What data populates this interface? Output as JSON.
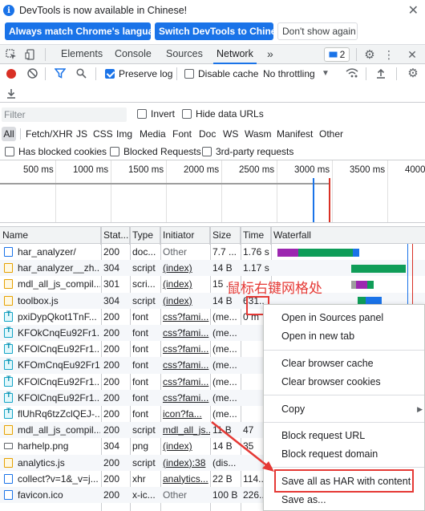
{
  "infobar": {
    "message": "DevTools is now available in Chinese!",
    "btn_match": "Always match Chrome's language",
    "btn_switch": "Switch DevTools to Chinese",
    "btn_dismiss": "Don't show again",
    "close": "✕"
  },
  "tabs": {
    "elements": "Elements",
    "console": "Console",
    "sources": "Sources",
    "network": "Network",
    "more": "»",
    "issues_count": "2"
  },
  "toolbar": {
    "preserve_log": "Preserve log",
    "disable_cache": "Disable cache",
    "throttling": "No throttling"
  },
  "filter": {
    "placeholder": "Filter",
    "invert": "Invert",
    "hide_data_urls": "Hide data URLs",
    "types": [
      "All",
      "Fetch/XHR",
      "JS",
      "CSS",
      "Img",
      "Media",
      "Font",
      "Doc",
      "WS",
      "Wasm",
      "Manifest",
      "Other"
    ],
    "has_blocked_cookies": "Has blocked cookies",
    "blocked_requests": "Blocked Requests",
    "third_party": "3rd-party requests"
  },
  "overview": {
    "ticks": [
      "500 ms",
      "1000 ms",
      "1500 ms",
      "2000 ms",
      "2500 ms",
      "3000 ms",
      "3500 ms",
      "4000"
    ]
  },
  "table": {
    "headers": [
      "Name",
      "Stat...",
      "Type",
      "Initiator",
      "Size",
      "Time",
      "Waterfall"
    ],
    "rows": [
      {
        "name": "har_analyzer/",
        "status": "200",
        "type": "doc...",
        "initiator": "Other",
        "size": "7.7 ...",
        "time": "1.76 s",
        "icon": "doc",
        "init_link": false
      },
      {
        "name": "har_analyzer__zh...",
        "status": "304",
        "type": "script",
        "initiator": "(index)",
        "size": "14 B",
        "time": "1.17 s",
        "icon": "js",
        "init_link": true
      },
      {
        "name": "mdl_all_js_compil...",
        "status": "301",
        "type": "scri...",
        "initiator": "(index)",
        "size": "15 ...",
        "time": "",
        "icon": "js",
        "init_link": true
      },
      {
        "name": "toolbox.js",
        "status": "304",
        "type": "script",
        "initiator": "(index)",
        "size": "14 B",
        "time": "631..",
        "icon": "js",
        "init_link": true
      },
      {
        "name": "pxiDypQkot1TnF...",
        "status": "200",
        "type": "font",
        "initiator": "css?fami...",
        "size": "(me...",
        "time": "0 m",
        "icon": "font",
        "init_link": true
      },
      {
        "name": "KFOkCnqEu92Fr1...",
        "status": "200",
        "type": "font",
        "initiator": "css?fami...",
        "size": "(me...",
        "time": "",
        "icon": "font",
        "init_link": true
      },
      {
        "name": "KFOlCnqEu92Fr1...",
        "status": "200",
        "type": "font",
        "initiator": "css?fami...",
        "size": "(me...",
        "time": "",
        "icon": "font",
        "init_link": true
      },
      {
        "name": "KFOmCnqEu92Fr1...",
        "status": "200",
        "type": "font",
        "initiator": "css?fami...",
        "size": "(me...",
        "time": "",
        "icon": "font",
        "init_link": true
      },
      {
        "name": "KFOlCnqEu92Fr1...",
        "status": "200",
        "type": "font",
        "initiator": "css?fami...",
        "size": "(me...",
        "time": "",
        "icon": "font",
        "init_link": true
      },
      {
        "name": "KFOlCnqEu92Fr1...",
        "status": "200",
        "type": "font",
        "initiator": "css?fami...",
        "size": "(me...",
        "time": "",
        "icon": "font",
        "init_link": true
      },
      {
        "name": "flUhRq6tzZclQEJ-...",
        "status": "200",
        "type": "font",
        "initiator": "icon?fa...",
        "size": "(me...",
        "time": "",
        "icon": "font",
        "init_link": true
      },
      {
        "name": "mdl_all_js_compil...",
        "status": "200",
        "type": "script",
        "initiator": "mdl_all_js...",
        "size": "11 B",
        "time": "47",
        "icon": "js",
        "init_link": true
      },
      {
        "name": "harhelp.png",
        "status": "304",
        "type": "png",
        "initiator": "(index)",
        "size": "14 B",
        "time": "35",
        "icon": "img",
        "init_link": true
      },
      {
        "name": "analytics.js",
        "status": "200",
        "type": "script",
        "initiator": "(index):38",
        "size": "(dis...",
        "time": "",
        "icon": "js",
        "init_link": true
      },
      {
        "name": "collect?v=1&_v=j...",
        "status": "200",
        "type": "xhr",
        "initiator": "analytics...",
        "size": "22 B",
        "time": "114..",
        "icon": "doc",
        "init_link": true
      },
      {
        "name": "favicon.ico",
        "status": "200",
        "type": "x-ic...",
        "initiator": "Other",
        "size": "100 B",
        "time": "226..",
        "icon": "doc",
        "init_link": false
      }
    ]
  },
  "context_menu": {
    "open_sources": "Open in Sources panel",
    "open_tab": "Open in new tab",
    "clear_cache": "Clear browser cache",
    "clear_cookies": "Clear browser cookies",
    "copy": "Copy",
    "block_url": "Block request URL",
    "block_domain": "Block request domain",
    "save_har": "Save all as HAR with content",
    "save_as": "Save as..."
  },
  "annotation": {
    "text": "鼠标右键网格处"
  },
  "colors": {
    "accent": "#1a73e8",
    "record": "#d93025",
    "annotation": "#e53935"
  }
}
